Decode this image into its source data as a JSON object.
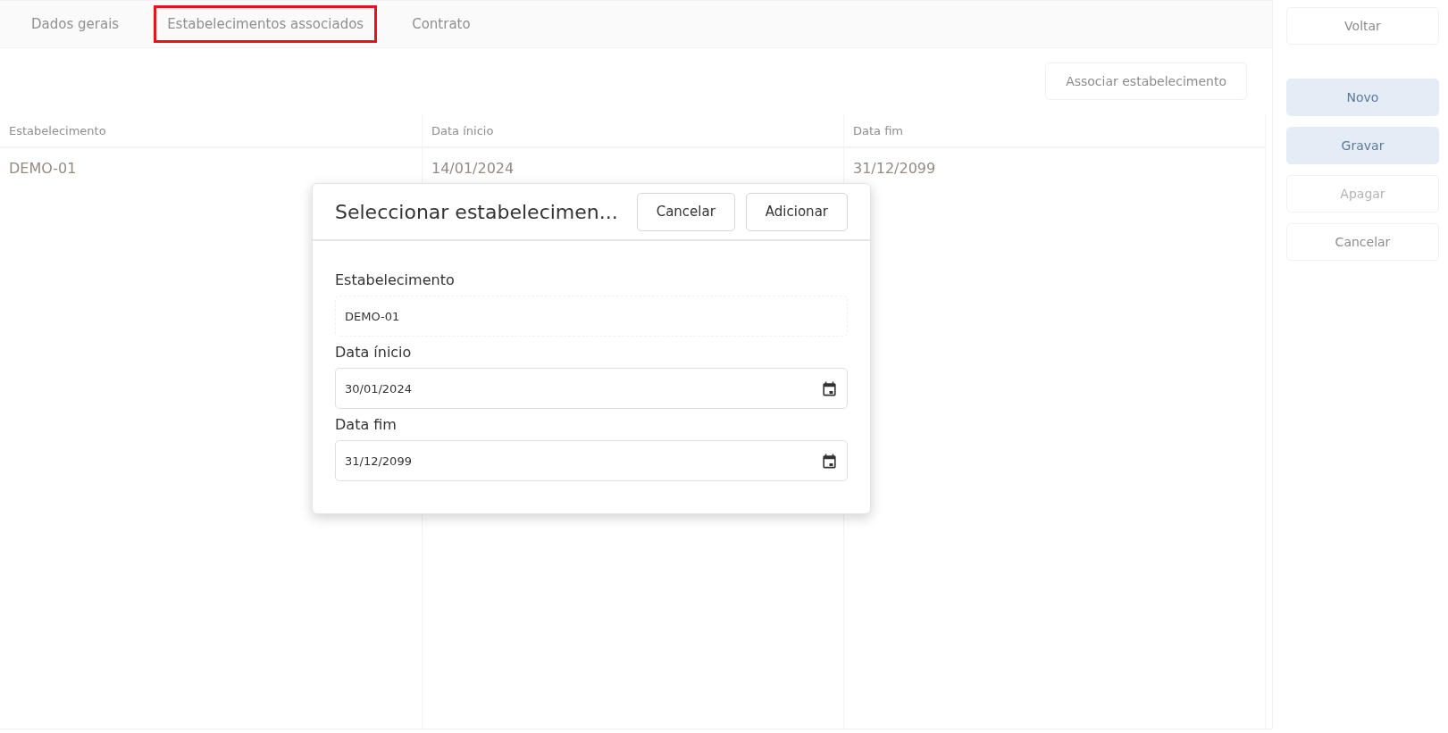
{
  "tabs": [
    {
      "label": "Dados gerais",
      "selected": false
    },
    {
      "label": "Estabelecimentos associados",
      "selected": true
    },
    {
      "label": "Contrato",
      "selected": false
    }
  ],
  "toolbar": {
    "button": "Associar estabelecimento"
  },
  "table": {
    "columns": [
      "Estabelecimento",
      "Data ínicio",
      "Data fim"
    ],
    "rows": [
      [
        "DEMO-01",
        "14/01/2024",
        "31/12/2099"
      ]
    ]
  },
  "sidebar": {
    "buttons": [
      {
        "label": "Voltar",
        "kind": "outline",
        "disabled": false
      },
      {
        "label": "Novo",
        "kind": "primary",
        "disabled": false
      },
      {
        "label": "Gravar",
        "kind": "primary",
        "disabled": false
      },
      {
        "label": "Apagar",
        "kind": "outline",
        "disabled": true
      },
      {
        "label": "Cancelar",
        "kind": "outline",
        "disabled": false
      }
    ]
  },
  "dialog": {
    "title": "Seleccionar estabelecimen...",
    "buttons": [
      "Cancelar",
      "Adicionar"
    ],
    "fields": [
      {
        "label": "Estabelecimento",
        "value": "DEMO-01",
        "kind": "text",
        "readonly": true
      },
      {
        "label": "Data ínicio",
        "value": "30/01/2024",
        "kind": "date",
        "readonly": false
      },
      {
        "label": "Data fim",
        "value": "31/12/2099",
        "kind": "date",
        "readonly": false
      }
    ]
  }
}
